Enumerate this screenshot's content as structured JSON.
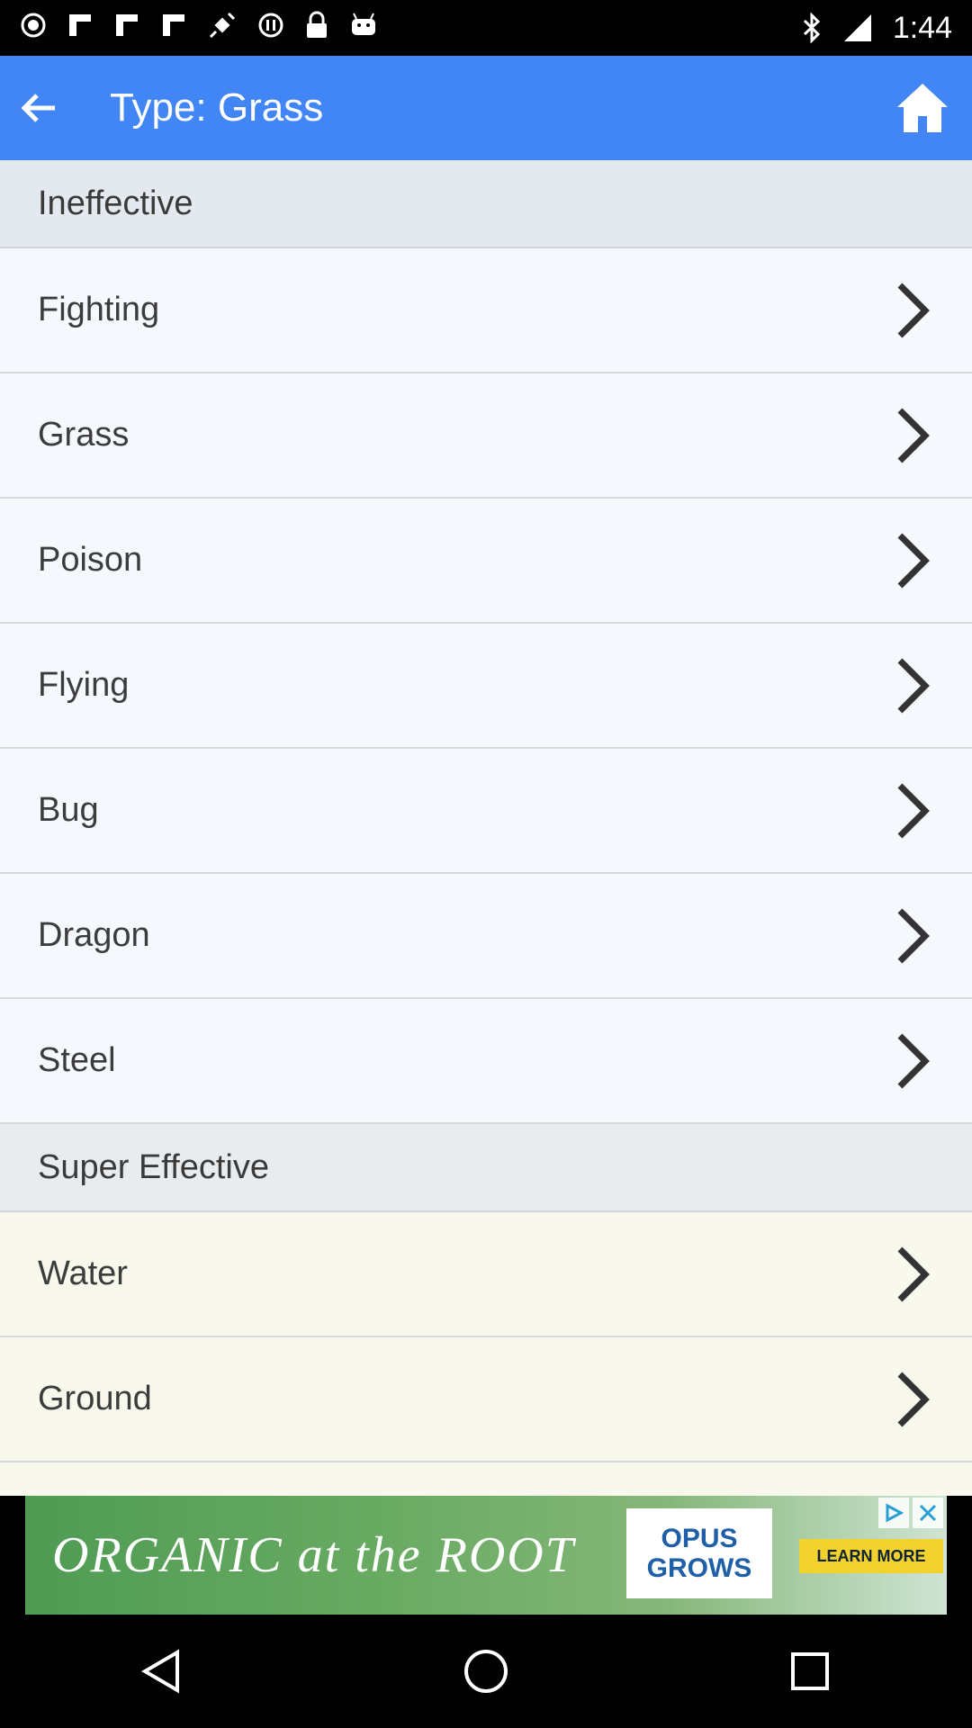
{
  "status_bar": {
    "time": "1:44",
    "left_icons": [
      "record-icon",
      "flipboard-icon",
      "flipboard-icon",
      "flipboard-icon",
      "fake-gps-icon",
      "pause-icon",
      "lock-icon",
      "android-icon"
    ],
    "right_icons": [
      "bluetooth-icon",
      "signal-icon"
    ]
  },
  "app_bar": {
    "title": "Type: Grass",
    "back_icon": "arrow-back-icon",
    "home_icon": "home-icon",
    "color": "#4285f4"
  },
  "sections": [
    {
      "header": "Ineffective",
      "items": [
        "Fighting",
        "Grass",
        "Poison",
        "Flying",
        "Bug",
        "Dragon",
        "Steel"
      ]
    },
    {
      "header": "Super Effective",
      "items": [
        "Water",
        "Ground"
      ]
    }
  ],
  "ad": {
    "headline": "ORGANIC at the ROOT",
    "brand_line1": "OPUS",
    "brand_line2": "GROWS",
    "cta": "LEARN MORE"
  },
  "nav_bar": {
    "icons": [
      "back-triangle-icon",
      "home-circle-icon",
      "recents-square-icon"
    ]
  }
}
